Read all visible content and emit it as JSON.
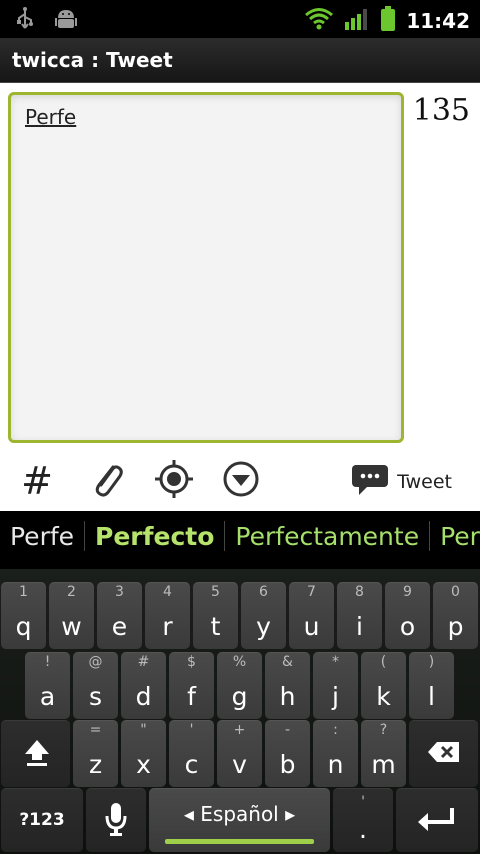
{
  "status_bar": {
    "time": "11:42",
    "icons": [
      "usb-icon",
      "android-debug-icon",
      "wifi-icon",
      "signal-icon",
      "battery-icon"
    ]
  },
  "app": {
    "title": "twicca : Tweet"
  },
  "compose": {
    "text": "Perfe",
    "char_count": "135"
  },
  "toolbar": {
    "hashtag_label": "#",
    "tweet_label": "Tweet",
    "icons": [
      "hashtag-icon",
      "attach-icon",
      "location-icon",
      "dropdown-icon",
      "speech-bubble-icon"
    ]
  },
  "suggestions": [
    "Perfe",
    "Perfecto",
    "Perfectamente",
    "Perfe"
  ],
  "keyboard": {
    "row1": [
      {
        "key": "q",
        "hint": "1"
      },
      {
        "key": "w",
        "hint": "2"
      },
      {
        "key": "e",
        "hint": "3"
      },
      {
        "key": "r",
        "hint": "4"
      },
      {
        "key": "t",
        "hint": "5"
      },
      {
        "key": "y",
        "hint": "6"
      },
      {
        "key": "u",
        "hint": "7"
      },
      {
        "key": "i",
        "hint": "8"
      },
      {
        "key": "o",
        "hint": "9"
      },
      {
        "key": "p",
        "hint": "0"
      }
    ],
    "row2": [
      {
        "key": "a",
        "hint": "!"
      },
      {
        "key": "s",
        "hint": "@"
      },
      {
        "key": "d",
        "hint": "#"
      },
      {
        "key": "f",
        "hint": "$"
      },
      {
        "key": "g",
        "hint": "%"
      },
      {
        "key": "h",
        "hint": "&"
      },
      {
        "key": "j",
        "hint": "*"
      },
      {
        "key": "k",
        "hint": "("
      },
      {
        "key": "l",
        "hint": ")"
      }
    ],
    "row3": [
      {
        "key": "z",
        "hint": "="
      },
      {
        "key": "x",
        "hint": "\""
      },
      {
        "key": "c",
        "hint": "'"
      },
      {
        "key": "v",
        "hint": "+"
      },
      {
        "key": "b",
        "hint": "-"
      },
      {
        "key": "n",
        "hint": ":"
      },
      {
        "key": "m",
        "hint": "?"
      }
    ],
    "sym_label": "?123",
    "language_label": "◂ Español ▸",
    "period_label": ".",
    "period_hint": "'",
    "accent_color": "#9cb630"
  }
}
